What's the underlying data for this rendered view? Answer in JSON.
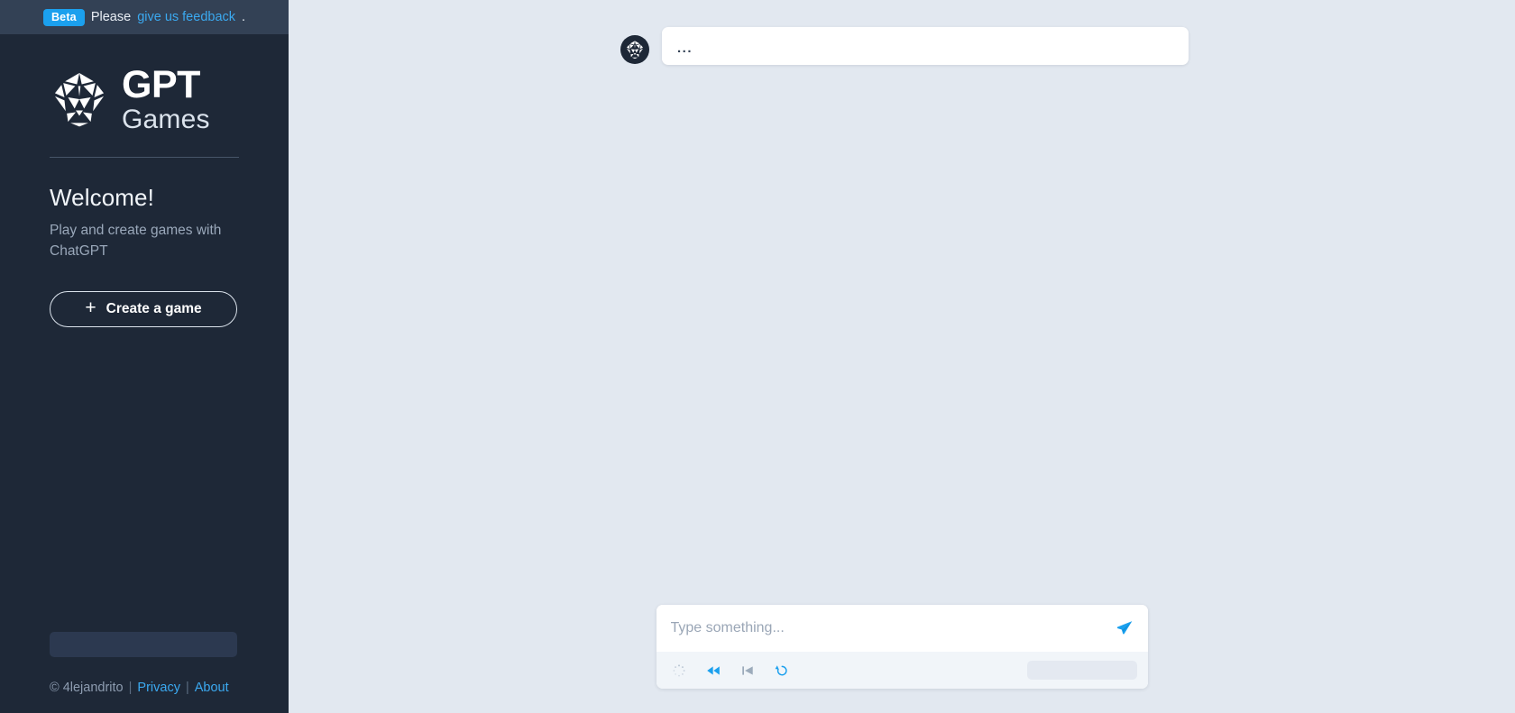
{
  "sidebar": {
    "banner": {
      "badge": "Beta",
      "prefix": "Please",
      "link": "give us feedback",
      "suffix": "."
    },
    "brand": {
      "mark_icon": "d20-dice-icon",
      "title": "GPT",
      "subtitle": "Games"
    },
    "welcome": {
      "title": "Welcome!",
      "subtitle": "Play and create games with ChatGPT"
    },
    "create_button": {
      "icon": "plus-icon",
      "label": "Create a game"
    },
    "footer": {
      "copyright": "© 4lejandrito",
      "sep1": "|",
      "privacy": "Privacy",
      "sep2": "|",
      "about": "About"
    }
  },
  "chat": {
    "messages": [
      {
        "avatar_icon": "d20-dice-icon",
        "author": "assistant",
        "text": "..."
      }
    ]
  },
  "composer": {
    "input_value": "",
    "input_placeholder": "Type something...",
    "send_icon": "paper-plane-icon",
    "tools": [
      {
        "name": "loading-spinner-icon",
        "label": "Loading",
        "state": "loading"
      },
      {
        "name": "rewind-icon",
        "label": "Rewind",
        "state": "enabled"
      },
      {
        "name": "step-back-icon",
        "label": "Step back",
        "state": "disabled"
      },
      {
        "name": "restart-icon",
        "label": "Restart",
        "state": "enabled"
      }
    ]
  },
  "colors": {
    "sidebar_bg": "#1e2837",
    "banner_bg": "#334155",
    "accent_blue": "#1ba0ee",
    "link_blue": "#3ba9f0",
    "main_bg": "#e2e8f0",
    "bubble_bg": "#ffffff",
    "toolbar_bg": "#f1f5f9",
    "disabled_gray": "#94a3b8"
  }
}
